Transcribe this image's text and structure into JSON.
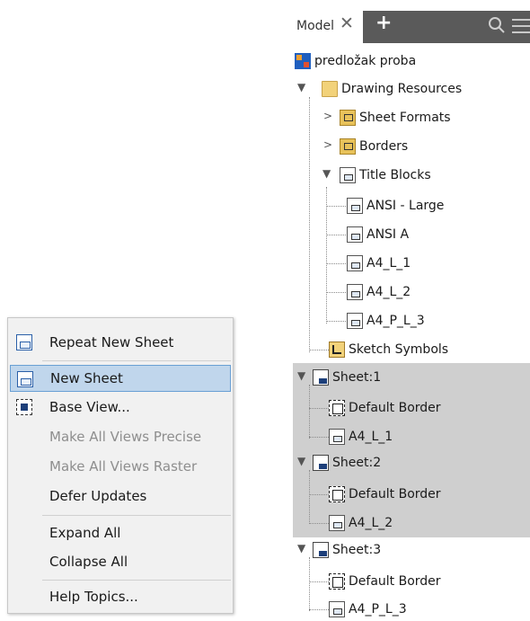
{
  "browser": {
    "tab_label": "Model",
    "close_glyph": "✕",
    "add_glyph": "+",
    "search_icon": "search-icon",
    "menu_icon": "hamburger-icon",
    "tree": {
      "root": "predložak proba",
      "drawing_resources": "Drawing Resources",
      "sheet_formats": "Sheet Formats",
      "borders": "Borders",
      "title_blocks": "Title Blocks",
      "title_block_items": [
        "ANSI - Large",
        "ANSI A",
        "A4_L_1",
        "A4_L_2",
        "A4_P_L_3"
      ],
      "sketch_symbols": "Sketch Symbols",
      "sheets": [
        {
          "name": "Sheet:1",
          "border": "Default Border",
          "title_block": "A4_L_1"
        },
        {
          "name": "Sheet:2",
          "border": "Default Border",
          "title_block": "A4_L_2"
        },
        {
          "name": "Sheet:3",
          "border": "Default Border",
          "title_block": "A4_P_L_3"
        }
      ]
    }
  },
  "context_menu": {
    "repeat_new_sheet": "Repeat New Sheet",
    "new_sheet": "New Sheet",
    "base_view": "Base View...",
    "make_all_precise": "Make All Views Precise",
    "make_all_raster": "Make All Views Raster",
    "defer_updates": "Defer Updates",
    "expand_all": "Expand All",
    "collapse_all": "Collapse All",
    "help_topics": "Help Topics..."
  },
  "colors": {
    "highlight": "#c0d6ec",
    "tab_dark": "#5a5a5a",
    "selected_rows": "#cfcfcf"
  }
}
